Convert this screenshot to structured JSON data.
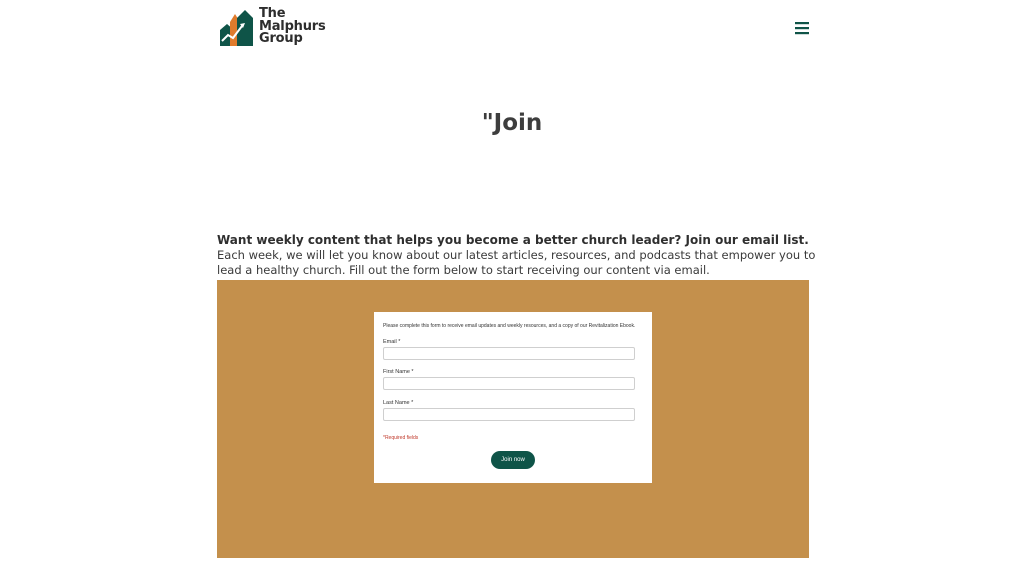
{
  "brand": {
    "line1": "The",
    "line2": "Malphurs",
    "line3": "Group",
    "logo_icon": "church-steeples-logo-icon",
    "colors": {
      "green": "#0f5448",
      "orange": "#e07b2c",
      "gold": "#c4904c"
    }
  },
  "nav": {
    "menu_icon": "hamburger-menu-icon"
  },
  "page": {
    "title": "\"Join"
  },
  "intro": {
    "heading": "Want weekly content that helps you become a better church leader? Join our email list.",
    "body": "Each week, we will let you know about our latest articles, resources, and podcasts that empower you to lead a healthy church. Fill out the form below to start receiving our content via email."
  },
  "form": {
    "intro": "Please complete this form to receive email updates and weekly resources, and a copy of our Revitalization Ebook.",
    "fields": [
      {
        "label": "Email *",
        "value": ""
      },
      {
        "label": "First Name *",
        "value": ""
      },
      {
        "label": "Last Name *",
        "value": ""
      }
    ],
    "required_note": "*Required fields",
    "submit_label": "Join now"
  }
}
